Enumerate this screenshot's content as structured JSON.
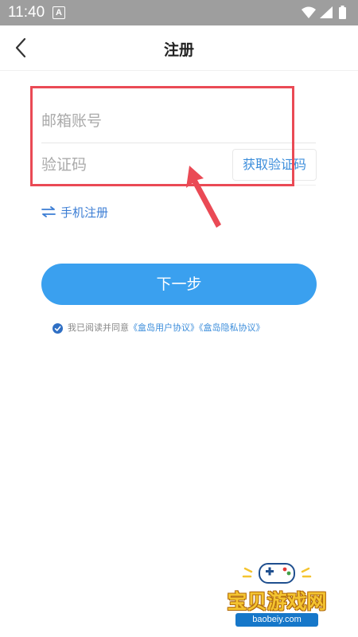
{
  "status_bar": {
    "time": "11:40",
    "notification_letter": "A",
    "icons": [
      "wifi-icon",
      "signal-icon",
      "battery-icon"
    ]
  },
  "header": {
    "title": "注册",
    "back_icon": "chevron-left-icon"
  },
  "form": {
    "email_placeholder": "邮箱账号",
    "email_value": "",
    "code_placeholder": "验证码",
    "code_value": "",
    "get_code_label": "获取验证码"
  },
  "switch_link": {
    "icon": "swap-arrows-icon",
    "label": "手机注册"
  },
  "next_button": {
    "label": "下一步"
  },
  "agreement": {
    "checked": true,
    "prefix": "我已阅读并同意",
    "link1": "《盒岛用户协议》",
    "link2": "《盒岛隐私协议》"
  },
  "watermark": {
    "title": "宝贝游戏网",
    "url": "baobeiy.com"
  },
  "colors": {
    "accent": "#3aa0ef",
    "link": "#3b8ddb",
    "annotation": "#ea4a55",
    "status_bar": "#9e9e9e"
  }
}
